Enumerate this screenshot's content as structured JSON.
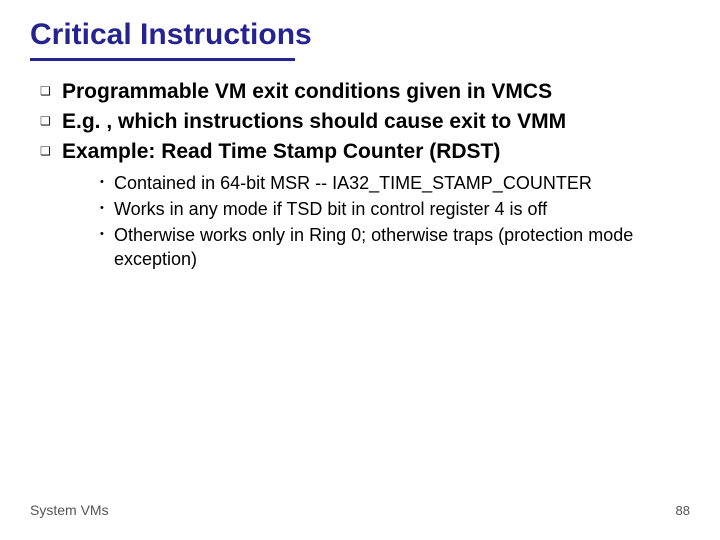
{
  "title": "Critical Instructions",
  "bullets": {
    "b1": "Programmable VM exit conditions given in VMCS",
    "b2": "E.g. , which instructions should cause exit to VMM",
    "b3": "Example: Read Time Stamp Counter (RDST)"
  },
  "subbullets": {
    "s1": "Contained in 64-bit MSR --  IA32_TIME_STAMP_COUNTER",
    "s2": "Works in any mode if TSD bit in control register 4 is off",
    "s3": "Otherwise works only in Ring 0; otherwise traps (protection mode exception)"
  },
  "footer": {
    "left": "System VMs",
    "page": "88"
  }
}
